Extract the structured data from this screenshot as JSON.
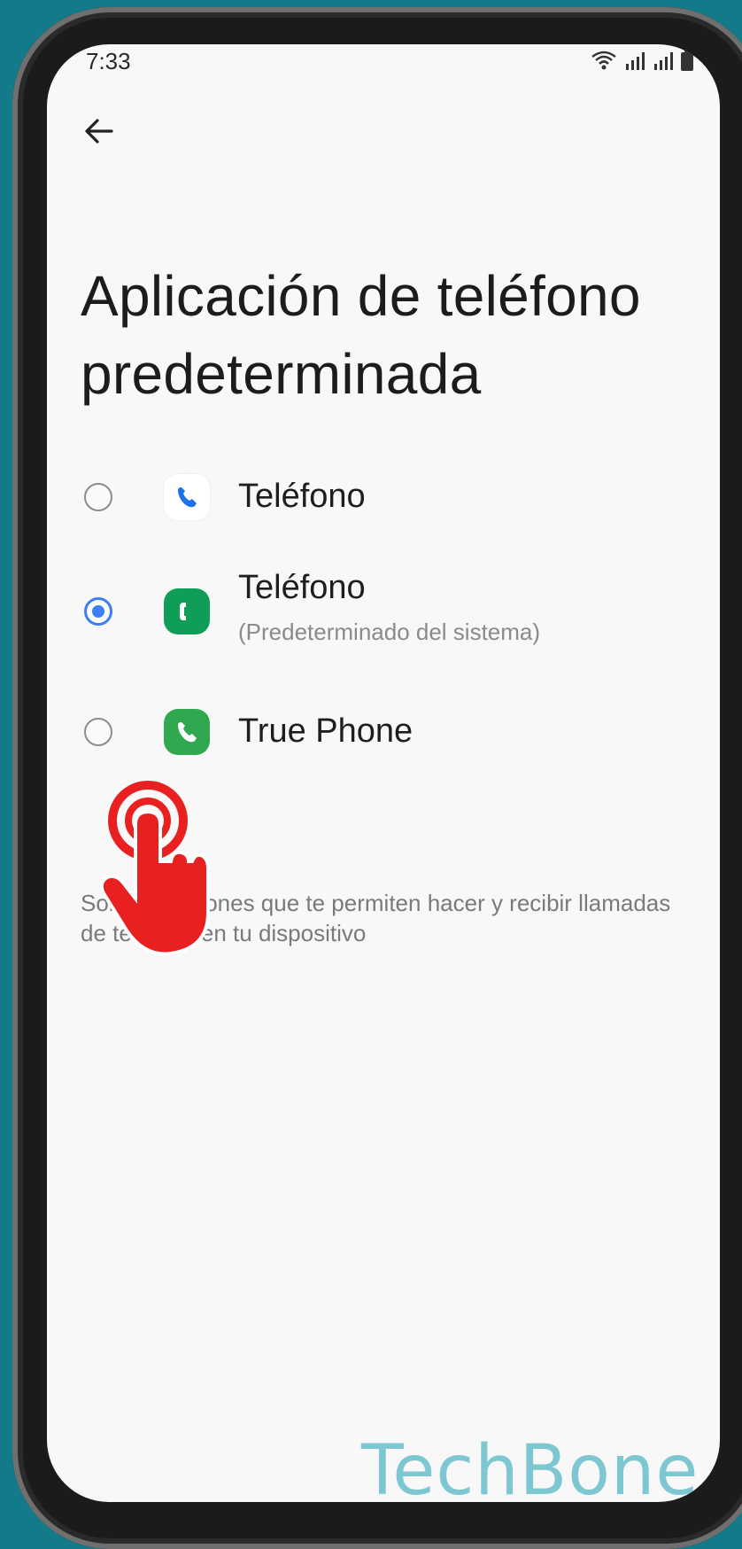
{
  "status_bar": {
    "time": "7:33",
    "icons": [
      "wifi-icon",
      "signal-icon",
      "signal-icon",
      "battery-icon"
    ]
  },
  "header": {
    "back_icon": "arrow-left-icon"
  },
  "title": "Aplicación de teléfono predeterminada",
  "options": [
    {
      "label": "Teléfono",
      "sublabel": "",
      "selected": false,
      "icon": "google-phone-icon",
      "icon_color": "#1a73e8"
    },
    {
      "label": "Teléfono",
      "sublabel": "(Predeterminado del sistema)",
      "selected": true,
      "icon": "samsung-phone-icon",
      "icon_color": "#0f9d58"
    },
    {
      "label": "True Phone",
      "sublabel": "",
      "selected": false,
      "icon": "true-phone-icon",
      "icon_color": "#2fa84f"
    }
  ],
  "description": "Son aplicaciones que te permiten hacer y recibir llamadas de teléfono en tu dispositivo",
  "watermark": "TechBone",
  "colors": {
    "accent": "#3b7ef5",
    "background": "#f8f8f8",
    "frame_bg": "#137a8a",
    "cursor": "#e82020"
  }
}
